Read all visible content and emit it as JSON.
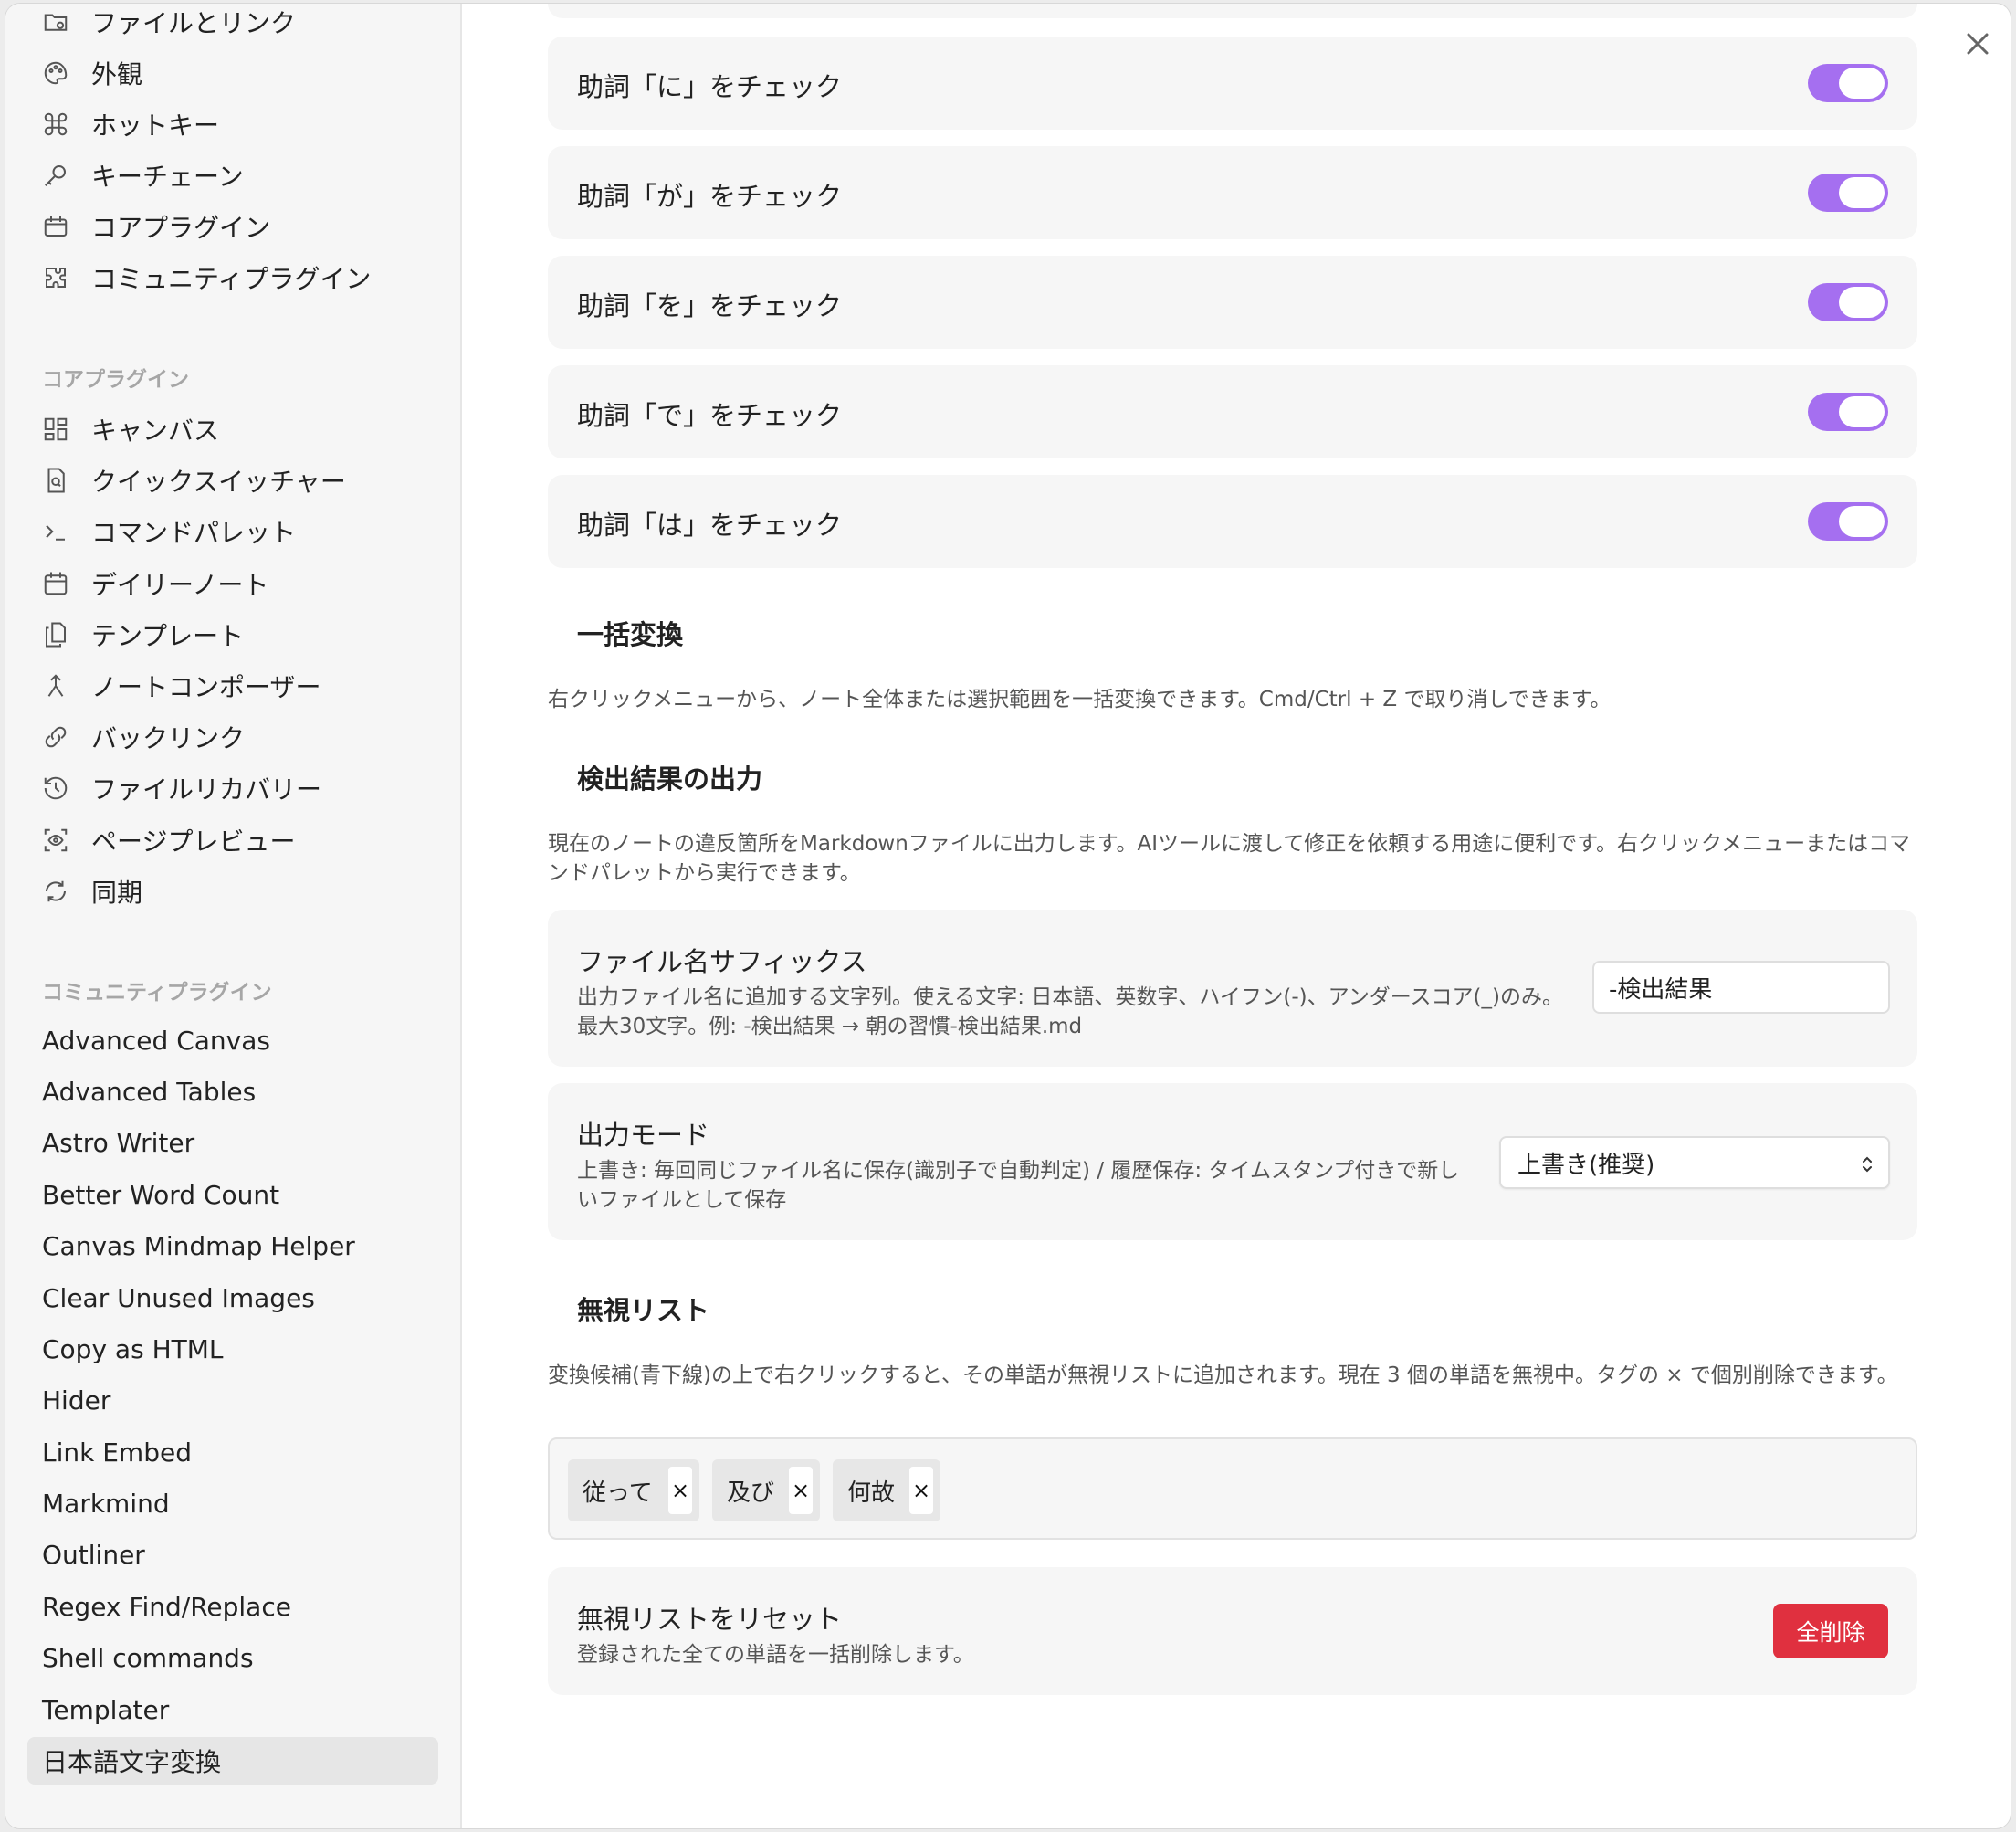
{
  "sidebar": {
    "options_items": [
      {
        "icon": "folder-link-icon",
        "label": "ファイルとリンク"
      },
      {
        "icon": "palette-icon",
        "label": "外観"
      },
      {
        "icon": "command-icon",
        "label": "ホットキー"
      },
      {
        "icon": "key-icon",
        "label": "キーチェーン"
      },
      {
        "icon": "calendar-box-icon",
        "label": "コアプラグイン"
      },
      {
        "icon": "puzzle-icon",
        "label": "コミュニティプラグイン"
      }
    ],
    "core_header": "コアプラグイン",
    "core_items": [
      {
        "icon": "canvas-grid-icon",
        "label": "キャンバス"
      },
      {
        "icon": "file-search-icon",
        "label": "クイックスイッチャー"
      },
      {
        "icon": "terminal-icon",
        "label": "コマンドパレット"
      },
      {
        "icon": "calendar-icon",
        "label": "デイリーノート"
      },
      {
        "icon": "files-icon",
        "label": "テンプレート"
      },
      {
        "icon": "merge-icon",
        "label": "ノートコンポーザー"
      },
      {
        "icon": "link-search-icon",
        "label": "バックリンク"
      },
      {
        "icon": "history-icon",
        "label": "ファイルリカバリー"
      },
      {
        "icon": "eye-scan-icon",
        "label": "ページプレビュー"
      },
      {
        "icon": "sync-icon",
        "label": "同期"
      }
    ],
    "community_header": "コミュニティプラグイン",
    "community_items": [
      "Advanced Canvas",
      "Advanced Tables",
      "Astro Writer",
      "Better Word Count",
      "Canvas Mindmap Helper",
      "Clear Unused Images",
      "Copy as HTML",
      "Hider",
      "Link Embed",
      "Markmind",
      "Outliner",
      "Regex Find/Replace",
      "Shell commands",
      "Templater",
      "日本語文字変換"
    ],
    "selected": "日本語文字変換"
  },
  "toggles": [
    {
      "label": "助詞「に」をチェック",
      "on": true
    },
    {
      "label": "助詞「が」をチェック",
      "on": true
    },
    {
      "label": "助詞「を」をチェック",
      "on": true
    },
    {
      "label": "助詞「で」をチェック",
      "on": true
    },
    {
      "label": "助詞「は」をチェック",
      "on": true
    }
  ],
  "bulk": {
    "heading": "一括変換",
    "desc": "右クリックメニューから、ノート全体または選択範囲を一括変換できます。Cmd/Ctrl + Z で取り消しできます。"
  },
  "output": {
    "heading": "検出結果の出力",
    "desc": "現在のノートの違反箇所をMarkdownファイルに出力します。AIツールに渡して修正を依頼する用途に便利です。右クリックメニューまたはコマンドパレットから実行できます。",
    "suffix_title": "ファイル名サフィックス",
    "suffix_desc": "出力ファイル名に追加する文字列。使える文字: 日本語、英数字、ハイフン(-)、アンダースコア(_)のみ。最大30文字。例: -検出結果 → 朝の習慣-検出結果.md",
    "suffix_value": "-検出結果",
    "mode_title": "出力モード",
    "mode_desc": "上書き: 毎回同じファイル名に保存(識別子で自動判定) / 履歴保存: タイムスタンプ付きで新しいファイルとして保存",
    "mode_value": "上書き(推奨)"
  },
  "ignore": {
    "heading": "無視リスト",
    "desc": "変換候補(青下線)の上で右クリックすると、その単語が無視リストに追加されます。現在 3 個の単語を無視中。タグの × で個別削除できます。",
    "tags": [
      "従って",
      "及び",
      "何故"
    ],
    "remove_glyph": "×",
    "reset_title": "無視リストをリセット",
    "reset_desc": "登録された全ての単語を一括削除します。",
    "reset_button": "全削除"
  },
  "colors": {
    "accent": "#a56ff0",
    "danger": "#e0303f"
  }
}
